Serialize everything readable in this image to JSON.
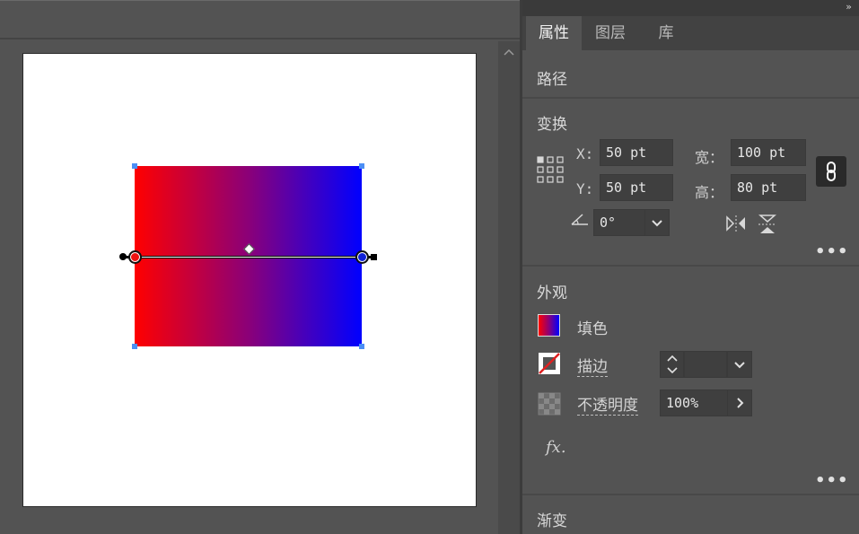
{
  "tabs": [
    {
      "label": "属性",
      "active": true
    },
    {
      "label": "图层",
      "active": false
    },
    {
      "label": "库",
      "active": false
    }
  ],
  "panel_expand_glyph": "»",
  "sections": {
    "path": {
      "title": "路径"
    },
    "transform": {
      "title": "变换",
      "x_label": "X:",
      "x_value": "50 pt",
      "y_label": "Y:",
      "y_value": "50 pt",
      "width_label": "宽：",
      "width_value": "100 pt",
      "height_label": "高：",
      "height_value": "80 pt",
      "angle_value": "0°",
      "more": "•••"
    },
    "appearance": {
      "title": "外观",
      "fill_label": "填色",
      "stroke_label": "描边",
      "stroke_value": "",
      "opacity_label": "不透明度",
      "opacity_value": "100%",
      "fx_label": "fx.",
      "more": "•••"
    },
    "gradient": {
      "title": "渐变"
    }
  },
  "colors": {
    "gradient_start": "#ff0000",
    "gradient_mid": "#8b0078",
    "gradient_end": "#0000ff",
    "selection_handle": "#4c8ff5",
    "panel_bg": "#535353"
  },
  "icons": [
    "reference-point-icon",
    "link-proportions-icon",
    "angle-icon",
    "flip-horizontal-icon",
    "flip-vertical-icon",
    "stroke-none-icon",
    "opacity-checker-icon",
    "chevron-down-icon",
    "chevron-right-icon",
    "spinner-icon",
    "collapse-panel-icon"
  ]
}
